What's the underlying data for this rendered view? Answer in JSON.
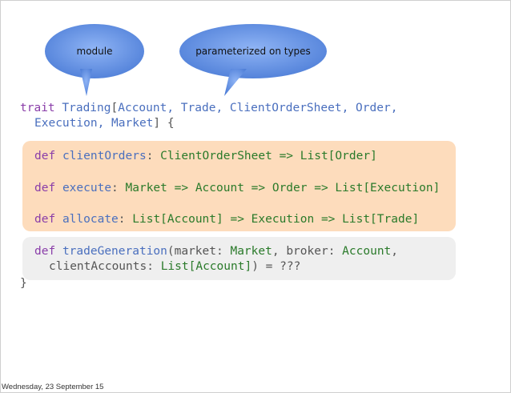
{
  "bubbles": {
    "module": "module",
    "types": "parameterized on types"
  },
  "code": {
    "line1": {
      "kw": "trait",
      "name": "Trading",
      "open": "[",
      "params": "Account, Trade, ClientOrderSheet, Order,"
    },
    "line2": {
      "params": "Execution, Market",
      "close": "] {"
    },
    "def1": {
      "kw": "def",
      "name": "clientOrders",
      "colon": ": ",
      "sig": "ClientOrderSheet => List[Order]"
    },
    "def2": {
      "kw": "def",
      "name": "execute",
      "colon": ": ",
      "sig": "Market => Account => Order => List[Execution]"
    },
    "def3": {
      "kw": "def",
      "name": "allocate",
      "colon": ": ",
      "sig": "List[Account] => Execution => List[Trade]"
    },
    "def4": {
      "kw": "def",
      "name": "tradeGeneration",
      "p1": "(market: ",
      "t1": "Market",
      "p2": ", broker: ",
      "t2": "Account",
      "p3": ","
    },
    "def4b": {
      "p1": "clientAccounts: ",
      "t1": "List[Account]",
      "p2": ") = ???"
    },
    "close": "}"
  },
  "footer": "Wednesday, 23 September 15",
  "colors": {
    "bubble": "#5f8ee0",
    "orange_box": "#fddcbc",
    "gray_box": "#efefef"
  }
}
